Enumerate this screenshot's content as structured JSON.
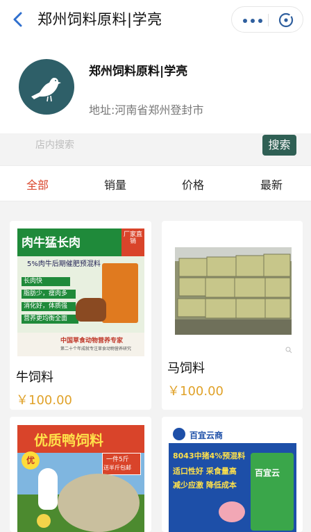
{
  "header": {
    "title": "郑州饲料原料|学亮"
  },
  "shop": {
    "name": "郑州饲料原料|学亮",
    "address": "地址:河南省郑州登封市"
  },
  "search": {
    "placeholder": "店内搜索",
    "button_label": "搜索"
  },
  "tabs": [
    {
      "label": "全部",
      "active": true
    },
    {
      "label": "销量",
      "active": false
    },
    {
      "label": "价格",
      "active": false
    },
    {
      "label": "最新",
      "active": false
    }
  ],
  "products": [
    {
      "name": "牛饲料",
      "price": "￥100.00",
      "image": {
        "headline": "肉牛猛长肉",
        "sub": "5%肉牛后期催肥预混料",
        "corner": "厂家直销",
        "bullets": [
          "长肉快",
          "脂肪少，瘦肉多",
          "消化好，体质强",
          "营养更均衡全面"
        ],
        "footer": "中国草食动物营养专家",
        "footnote": "第二十个年成就专注草食动物营养研究"
      }
    },
    {
      "name": "马饲料",
      "price": "￥100.00",
      "image": {}
    },
    {
      "name": "",
      "price": "",
      "image": {
        "headline": "优质鸭饲料",
        "tag_line1": "一件5斤",
        "tag_line2": "送半斤包邮",
        "badge": "优"
      }
    },
    {
      "name": "",
      "price": "",
      "image": {
        "brand": "百宜云商",
        "headline": "8043中猪4%预混料",
        "line1": "适口性好  采食量高",
        "line2": "减少应激  降低成本",
        "bag_label": "百宜云"
      }
    }
  ],
  "colors": {
    "accent_red": "#d9442a",
    "price": "#e0a22a",
    "search_button": "#2f5f54",
    "logo_bg": "#2e5f68"
  }
}
